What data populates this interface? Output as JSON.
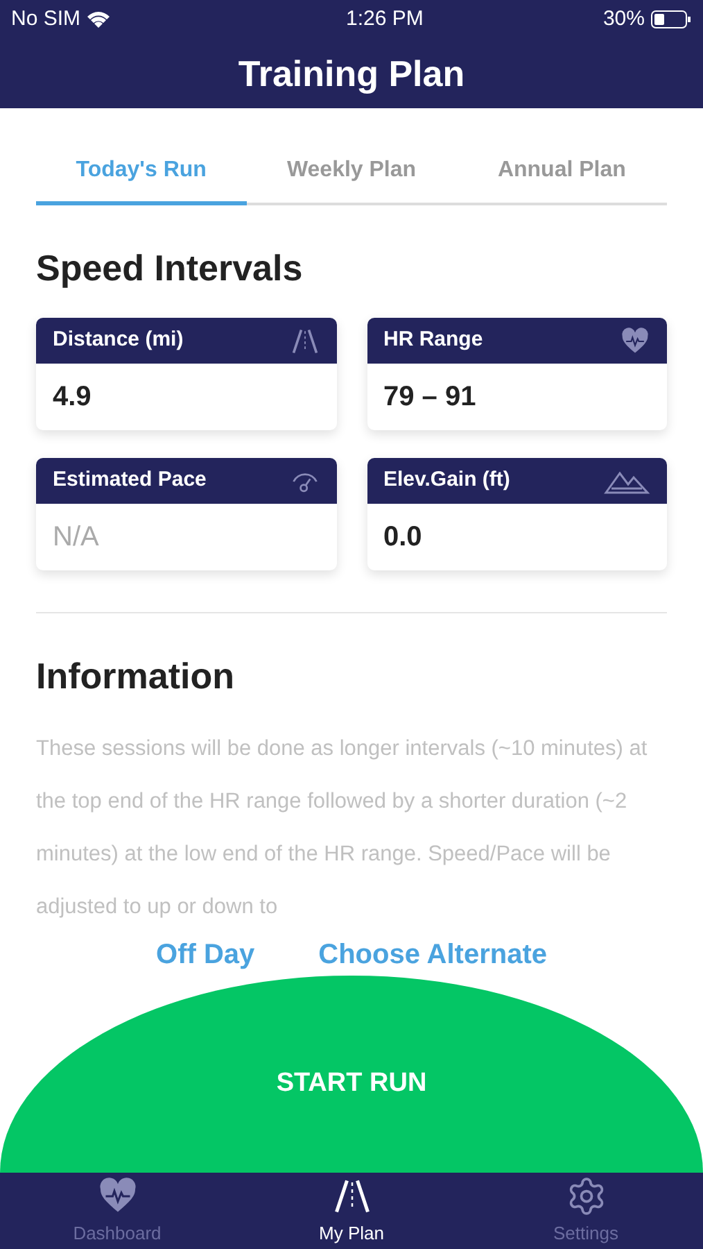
{
  "status_bar": {
    "carrier": "No SIM",
    "time": "1:26 PM",
    "battery": "30%"
  },
  "header": {
    "title": "Training Plan"
  },
  "tabs": [
    {
      "label": "Today's Run",
      "selected": true
    },
    {
      "label": "Weekly Plan",
      "selected": false
    },
    {
      "label": "Annual Plan",
      "selected": false
    }
  ],
  "workout": {
    "title": "Speed Intervals"
  },
  "stats": [
    {
      "label": "Distance (mi)",
      "kind": "road",
      "value": "4.9",
      "muted": false
    },
    {
      "label": "HR Range",
      "kind": "heart",
      "value": "79 – 91",
      "muted": false
    },
    {
      "label": "Estimated Pace",
      "kind": "gauge",
      "value": "N/A",
      "muted": true
    },
    {
      "label": "Elev.Gain (ft)",
      "kind": "mountain",
      "value": "0.0",
      "muted": false
    }
  ],
  "information": {
    "title": "Information",
    "text": "These sessions will be done as longer intervals (~10 minutes) at the top end of the HR range followed by a shorter duration (~2 minutes) at the low end of the HR range.  Speed/Pace will be adjusted to up or down to"
  },
  "links": [
    "Off Day",
    "Choose Alternate"
  ],
  "start_button": {
    "label": "START RUN"
  },
  "nav": [
    {
      "label": "Dashboard",
      "kind": "heart",
      "selected": false
    },
    {
      "label": "My Plan",
      "kind": "road",
      "selected": true
    },
    {
      "label": "Settings",
      "kind": "gear",
      "selected": false
    }
  ]
}
